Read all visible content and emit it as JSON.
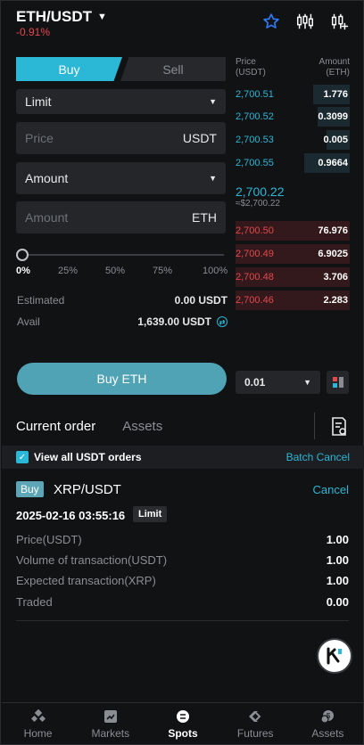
{
  "header": {
    "pair": "ETH/USDT",
    "change": "-0.91%"
  },
  "trade": {
    "tab_buy": "Buy",
    "tab_sell": "Sell",
    "order_type": "Limit",
    "price_placeholder": "Price",
    "price_unit": "USDT",
    "amount_mode": "Amount",
    "amount_placeholder": "Amount",
    "amount_unit": "ETH",
    "slider_percent": 0,
    "ticks": [
      "0%",
      "25%",
      "50%",
      "75%",
      "100%"
    ],
    "estimated_label": "Estimated",
    "estimated_value": "0.00 USDT",
    "avail_label": "Avail",
    "avail_value": "1,639.00  USDT",
    "buy_button": "Buy ETH"
  },
  "orderbook": {
    "price_header": "Price",
    "price_unit": "(USDT)",
    "amount_header": "Amount",
    "amount_unit": "(ETH)",
    "asks": [
      {
        "price": "2,700.51",
        "amount": "1.776",
        "depth": 0.32
      },
      {
        "price": "2,700.52",
        "amount": "0.3099",
        "depth": 0.28
      },
      {
        "price": "2,700.53",
        "amount": "0.005",
        "depth": 0.2
      },
      {
        "price": "2,700.55",
        "amount": "0.9664",
        "depth": 0.4
      }
    ],
    "mid_price": "2,700.22",
    "mid_fiat": "≈$2,700.22",
    "bids": [
      {
        "price": "2,700.50",
        "amount": "76.976",
        "depth": 1.0
      },
      {
        "price": "2,700.49",
        "amount": "6.9025",
        "depth": 1.0
      },
      {
        "price": "2,700.48",
        "amount": "3.706",
        "depth": 1.0
      },
      {
        "price": "2,700.46",
        "amount": "2.283",
        "depth": 1.0
      }
    ],
    "depth_value": "0.01"
  },
  "orders": {
    "tab_current": "Current order",
    "tab_assets": "Assets",
    "filter_label": "View all USDT orders",
    "batch_cancel": "Batch Cancel",
    "item": {
      "side": "Buy",
      "symbol": "XRP/USDT",
      "cancel": "Cancel",
      "datetime": "2025-02-16 03:55:16",
      "type": "Limit",
      "rows": [
        {
          "label": "Price(USDT)",
          "value": "1.00"
        },
        {
          "label": "Volume of transaction(USDT)",
          "value": "1.00"
        },
        {
          "label": "Expected transaction(XRP)",
          "value": "1.00"
        },
        {
          "label": "Traded",
          "value": "0.00"
        }
      ]
    }
  },
  "nav": {
    "items": [
      {
        "label": "Home",
        "icon": "home-icon"
      },
      {
        "label": "Markets",
        "icon": "markets-icon"
      },
      {
        "label": "Spots",
        "icon": "spots-icon",
        "active": true
      },
      {
        "label": "Futures",
        "icon": "futures-icon"
      },
      {
        "label": "Assets",
        "icon": "assets-icon"
      }
    ]
  },
  "colors": {
    "accent": "#2bb7d6",
    "ask": "#2bb7d6",
    "bid": "#e5484d",
    "buy_button": "#4fa3b4"
  }
}
